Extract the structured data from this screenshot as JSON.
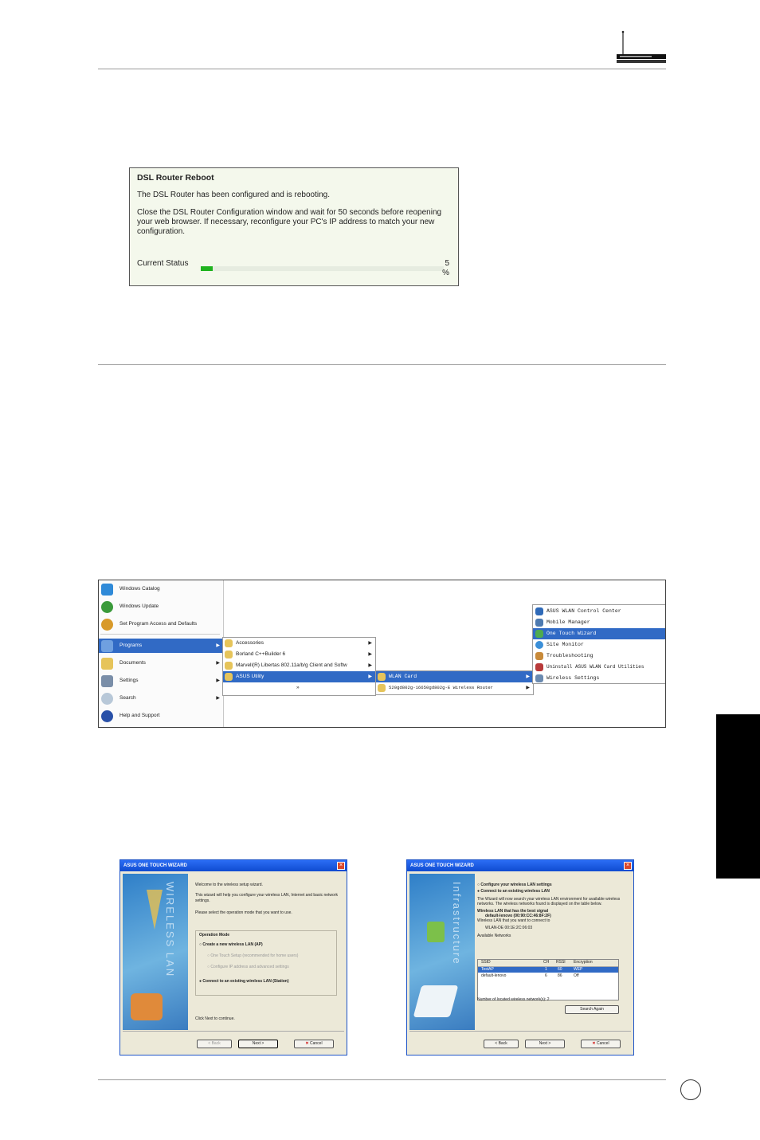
{
  "reboot": {
    "title": "DSL Router Reboot",
    "line1": "The DSL Router has been configured and is rebooting.",
    "line2": "Close the DSL Router Configuration window and wait for 50 seconds before reopening your web browser. If necessary, reconfigure your PC's IP address to match your new configuration.",
    "status_label": "Current Status",
    "status_value": "5",
    "status_unit": "%",
    "progress_percent": 5
  },
  "start_menu": {
    "left": [
      "Windows Catalog",
      "Windows Update",
      "Set Program Access and Defaults",
      "Programs",
      "Documents",
      "Settings",
      "Search",
      "Help and Support"
    ],
    "programs": [
      "Accessories",
      "Borland C++Builder 6",
      "Marvell(R) Libertas 802.11a/b/g Client and Softw",
      "ASUS Utility"
    ],
    "programs_more": "»",
    "asus_utility": [
      "WLAN Card",
      "520gd802g-16650gd802g-E Wireless Router"
    ],
    "wlan_card": [
      "ASUS WLAN Control Center",
      "Mobile Manager",
      "One Touch Wizard",
      "Site Monitor",
      "Troubleshooting",
      "Uninstall ASUS WLAN Card Utilities",
      "Wireless Settings"
    ]
  },
  "wizard1": {
    "title": "ASUS ONE TOUCH WIZARD",
    "side_text": "WIRELESS LAN",
    "p1": "Welcome to the wireless setup wizard.",
    "p2": "This wizard will help you configure your wireless LAN, Internet and basic network settings.",
    "p3": "Please select the operation mode that you want to use.",
    "group": "Operation Mode",
    "opt1": "Create a new wireless LAN (AP)",
    "opt1a": "One Touch Setup (recommended for home users)",
    "opt1b": "Configure IP address and advanced settings",
    "opt2": "Connect to an existing wireless LAN (Station)",
    "foot": "Click Next to continue.",
    "back": "< Back",
    "next": "Next >",
    "cancel": "Cancel"
  },
  "wizard2": {
    "title": "ASUS ONE TOUCH WIZARD",
    "side_text": "Infrastructure",
    "optA": "Configure your wireless LAN settings",
    "optB": "Connect to an existing wireless LAN",
    "desc": "The Wizard will now search your wireless LAN environment for available wireless networks. The wireless networks found is displayed on the table below.",
    "best": "Wireless LAN that has the best signal",
    "best_val": "default-lenovo (00:90:CC:46:8F:2F)",
    "want": "Wireless LAN that you want to connect to",
    "want_val": "WLAN-DE 00:1E:2C:06:03",
    "avail": "Available Networks",
    "cols": [
      "SSID",
      "CH",
      "RSSI",
      "Encryption"
    ],
    "rows": [
      [
        "TestAP",
        "1",
        "60",
        "WEP"
      ],
      [
        "default-lenovo",
        "6",
        "86",
        "Off"
      ]
    ],
    "count": "Number of located wireless network(s): 2",
    "search": "Search Again",
    "back": "< Back",
    "next": "Next >",
    "cancel": "Cancel"
  },
  "colors": {
    "accent": "#316ac5",
    "progress": "#1fb31f",
    "titlebar": "#0f4bd0"
  }
}
